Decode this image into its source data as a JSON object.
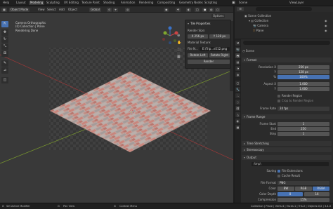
{
  "topbar": {
    "menu": [
      "Help"
    ],
    "workspaces": [
      "Layout",
      "Modeling",
      "Sculpting",
      "UV Editing",
      "Texture Paint",
      "Shading",
      "Animation",
      "Rendering",
      "Compositing",
      "Geometry Nodes",
      "Scripting"
    ],
    "active_workspace": "Modeling",
    "scene_label": "Scene",
    "viewlayer_label": "ViewLayer"
  },
  "viewport_header": {
    "mode": "Object Mode",
    "menus": [
      "View",
      "Select",
      "Add",
      "Object"
    ],
    "transform": "Global",
    "options_label": "Options"
  },
  "viewport_info": {
    "line1": "Camera Orthographic",
    "line2": "(0) Collection | Plane",
    "line3": "Rendering Done"
  },
  "tile_panel": {
    "title": "Tile Properties",
    "render_size_label": "Render Size:",
    "x_value": "X  256 px",
    "y_value": "Y  128 px",
    "material_label": "Material Texture:",
    "file_label": "File N...",
    "file_value": "E:\\Trip...e512.png",
    "rotate_left": "Rotate Left",
    "rotate_right": "Rotate Right",
    "render_button": "Render"
  },
  "toolbar_icons": [
    "cursor-icon",
    "move-icon",
    "rotate-icon",
    "scale-icon",
    "transform-icon",
    "annotate-icon",
    "measure-icon",
    "add-cube-icon"
  ],
  "statusbar": {
    "left": "Set Active Modifier",
    "mid1": "Pan View",
    "mid2": "Context Menu",
    "right": "Collection | Plane | Verts:4 | Faces:1 | Tris:2 | Objects:0/2 | 3.4.0"
  },
  "outliner": {
    "title": "Scene Collection",
    "items": [
      "Collection",
      "Camera",
      "Plane"
    ]
  },
  "properties": {
    "scene_name": "Scene",
    "format_section": "Format",
    "resolution_x_label": "Resolution X",
    "resolution_x": "256 px",
    "resolution_y_label": "Y",
    "resolution_y": "128 px",
    "percent_label": "%",
    "percent": "100%",
    "aspect_x_label": "Aspect X",
    "aspect_x": "1.000",
    "aspect_y_label": "Y",
    "aspect_y": "1.000",
    "render_region": "Render Region",
    "crop_region": "Crop to Render Region",
    "frame_rate_label": "Frame Rate",
    "frame_rate": "24 fps",
    "frame_range_section": "Frame Range",
    "frame_start_label": "Frame Start",
    "frame_start": "1",
    "end_label": "End",
    "end": "250",
    "step_label": "Step",
    "step": "1",
    "time_stretching": "Time Stretching",
    "stereoscopy": "Stereoscopy",
    "output_section": "Output",
    "output_path": "/tmp\\",
    "saving_label": "Saving",
    "file_extensions": "File Extensions",
    "cache_result": "Cache Result",
    "file_format_label": "File Format",
    "file_format": "PNG",
    "color_label": "Color",
    "color_options": [
      "BW",
      "RGB",
      "RGBA"
    ],
    "color_active": "RGBA",
    "color_depth_label": "Color Depth",
    "color_depth": [
      "8",
      "16"
    ],
    "compression_label": "Compression",
    "compression": "15%"
  },
  "colors": {
    "accent": "#4772b3",
    "viewport_bg": "#393939",
    "panel_bg": "#2a2a2a",
    "x_axis": "#a33b3b",
    "y_axis": "#7a9a2e"
  }
}
